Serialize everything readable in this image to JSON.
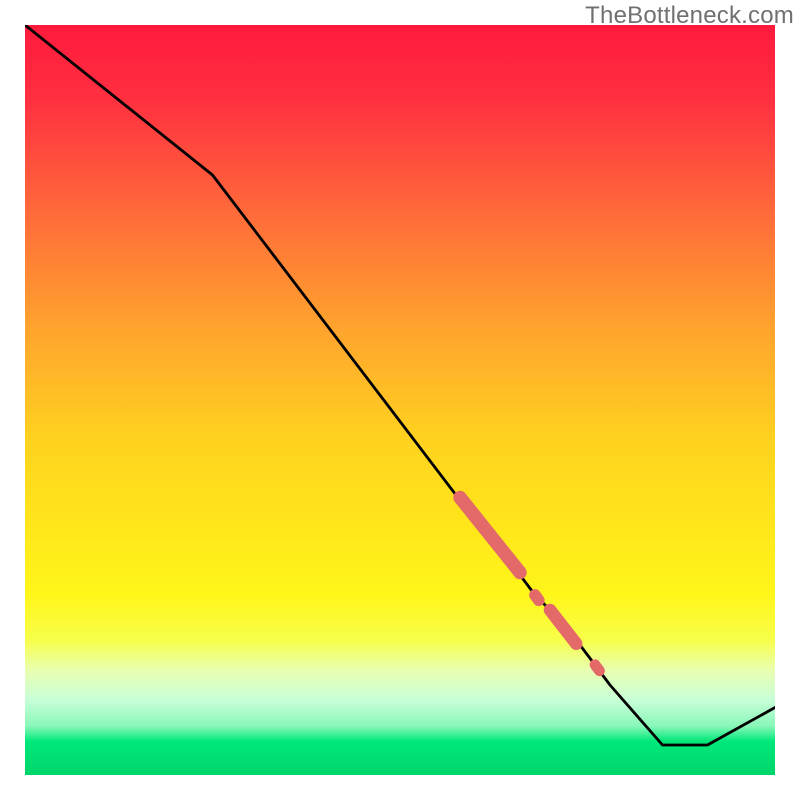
{
  "watermark": "TheBottleneck.com",
  "colors": {
    "gradient_stops": [
      {
        "offset": 0.0,
        "color": "#ff1a3d"
      },
      {
        "offset": 0.1,
        "color": "#ff3040"
      },
      {
        "offset": 0.25,
        "color": "#ff6a3a"
      },
      {
        "offset": 0.4,
        "color": "#ffa22e"
      },
      {
        "offset": 0.55,
        "color": "#ffd11f"
      },
      {
        "offset": 0.68,
        "color": "#ffe81a"
      },
      {
        "offset": 0.76,
        "color": "#fff61a"
      },
      {
        "offset": 0.82,
        "color": "#f7ff4a"
      },
      {
        "offset": 0.86,
        "color": "#e9ffb0"
      },
      {
        "offset": 0.9,
        "color": "#c8ffd8"
      },
      {
        "offset": 0.935,
        "color": "#88f7b8"
      },
      {
        "offset": 0.955,
        "color": "#00e87a"
      },
      {
        "offset": 1.0,
        "color": "#00d66a"
      }
    ],
    "line": "#000000",
    "marker": "#e46a6a"
  },
  "chart_data": {
    "type": "line",
    "title": "",
    "xlabel": "",
    "ylabel": "",
    "xlim": [
      0,
      100
    ],
    "ylim": [
      0,
      100
    ],
    "series": [
      {
        "name": "curve",
        "x": [
          0,
          25,
          60,
          62,
          65,
          68,
          70,
          72,
          75,
          78,
          85,
          91,
          100
        ],
        "y": [
          100,
          80,
          34,
          32,
          28,
          24,
          22,
          20,
          16,
          12,
          4,
          4,
          9
        ]
      }
    ],
    "markers": [
      {
        "name": "segment",
        "x_start": 58,
        "y_start": 37,
        "x_end": 66,
        "y_end": 27,
        "width": 3.0
      },
      {
        "name": "dot",
        "x_start": 68,
        "y_start": 24,
        "x_end": 68.5,
        "y_end": 23.3,
        "width": 2.6
      },
      {
        "name": "segment",
        "x_start": 70,
        "y_start": 22,
        "x_end": 73.5,
        "y_end": 17.5,
        "width": 2.8
      },
      {
        "name": "dot",
        "x_start": 76,
        "y_start": 14.7,
        "x_end": 76.6,
        "y_end": 13.9,
        "width": 2.4
      }
    ]
  }
}
